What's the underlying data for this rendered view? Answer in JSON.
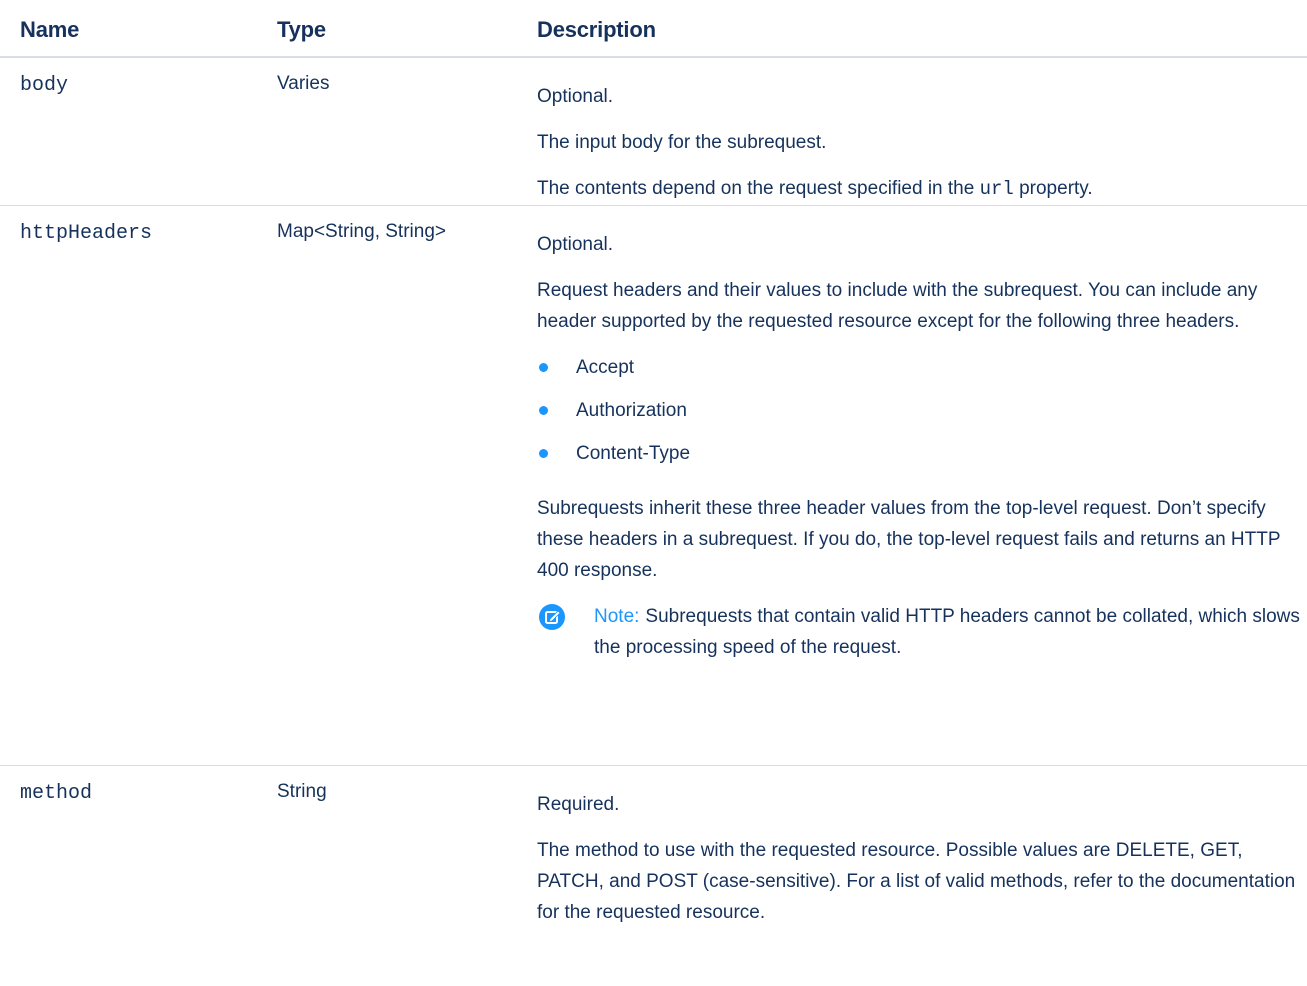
{
  "headers": {
    "name": "Name",
    "type": "Type",
    "description": "Description"
  },
  "rows": [
    {
      "name": "body",
      "type": "Varies",
      "desc": {
        "p1": "Optional.",
        "p2": "The input body for the subrequest.",
        "p3_before": "The contents depend on the request specified in the",
        "p3_code": "url",
        "p3_after": "property."
      }
    },
    {
      "name": "httpHeaders",
      "type": "Map<String, String>",
      "desc": {
        "p1": "Optional.",
        "p2": "Request headers and their values to include with the subrequest. You can include any header supported by the requested resource except for the following three headers.",
        "bullets": [
          "Accept",
          "Authorization",
          "Content-Type"
        ],
        "p3": "Subrequests inherit these three header values from the top-level request. Don’t specify these headers in a subrequest. If you do, the top-level request fails and returns an HTTP 400 response.",
        "note_label": "Note:",
        "note_text": "Subrequests that contain valid HTTP headers cannot be collated, which slows the processing speed of the request."
      }
    },
    {
      "name": "method",
      "type": "String",
      "desc": {
        "p1": "Required.",
        "p2": "The method to use with the requested resource. Possible values are DELETE, GET, PATCH, and POST (case-sensitive). For a list of valid methods, refer to the documentation for the requested resource."
      }
    }
  ],
  "colors": {
    "text": "#16325c",
    "accent": "#1b96ff",
    "divider": "#d8dde6"
  },
  "icons": {
    "bullet": "bullet-dot-icon",
    "note": "edit-note-icon"
  }
}
